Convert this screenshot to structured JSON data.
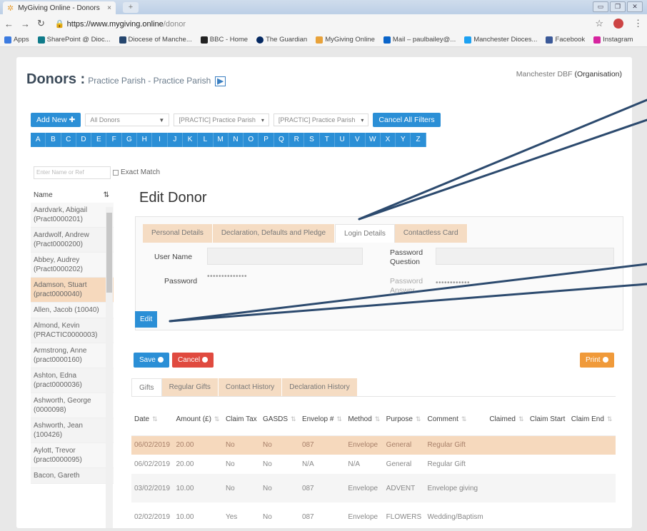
{
  "browser": {
    "tab_title": "MyGiving Online - Donors",
    "url_host": "https://www.mygiving.online",
    "url_path": "/donor",
    "bookmarks": [
      "Apps",
      "SharePoint @ Dioc...",
      "Diocese of Manche...",
      "BBC - Home",
      "The Guardian",
      "MyGiving Online",
      "Mail – paulbailey@...",
      "Manchester Dioces...",
      "Facebook",
      "Instagram"
    ]
  },
  "header": {
    "title": "Donors :",
    "subtitle": "Practice Parish - Practice Parish",
    "organisation_name": "Manchester DBF",
    "organisation_type": "(Organisation)"
  },
  "toolbar": {
    "add_new": "Add New",
    "filter_all": "All Donors",
    "filter_parish1": "[PRACTIC] Practice Parish",
    "filter_parish2": "[PRACTIC] Practice Parish",
    "cancel_filters": "Cancel All Filters"
  },
  "alphabet": [
    "A",
    "B",
    "C",
    "D",
    "E",
    "F",
    "G",
    "H",
    "I",
    "J",
    "K",
    "L",
    "M",
    "N",
    "O",
    "P",
    "Q",
    "R",
    "S",
    "T",
    "U",
    "V",
    "W",
    "X",
    "Y",
    "Z"
  ],
  "search": {
    "placeholder": "Enter Name or Ref",
    "exact_match": "Exact Match"
  },
  "donor_list": {
    "header": "Name",
    "items": [
      "Aardvark, Abigail (Pract0000201)",
      "Aardwolf, Andrew (Pract0000200)",
      "Abbey, Audrey (Pract0000202)",
      "Adamson, Stuart (pract0000040)",
      "Allen, Jacob (10040)",
      "Almond, Kevin (PRACTIC0000003)",
      "Armstrong, Anne (pract0000160)",
      "Ashton, Edna (pract0000036)",
      "Ashworth, George (0000098)",
      "Ashworth, Jean (100426)",
      "Aylott, Trevor (pract0000095)",
      "Bacon, Gareth"
    ]
  },
  "edit_donor": {
    "title": "Edit Donor",
    "tabs": [
      "Personal Details",
      "Declaration, Defaults and Pledge",
      "Login Details",
      "Contactless Card"
    ],
    "user_name_label": "User Name",
    "password_label": "Password",
    "password_value": "••••••••••••••",
    "password_question_label": "Password Question",
    "password_answer_label": "Password Answer",
    "password_answer_value": "••••••••••••",
    "edit_button": "Edit"
  },
  "actions": {
    "save": "Save",
    "cancel": "Cancel",
    "print": "Print"
  },
  "gift_tabs": [
    "Gifts",
    "Regular Gifts",
    "Contact History",
    "Declaration History"
  ],
  "gifts_table": {
    "columns": [
      "Date",
      "Amount (£)",
      "Claim Tax",
      "GASDS",
      "Envelop #",
      "Method",
      "Purpose",
      "Comment",
      "Claimed",
      "Claim Start",
      "Claim End"
    ],
    "rows": [
      [
        "06/02/2019",
        "20.00",
        "No",
        "No",
        "087",
        "Envelope",
        "General",
        "Regular Gift",
        "",
        "",
        ""
      ],
      [
        "06/02/2019",
        "20.00",
        "No",
        "No",
        "N/A",
        "N/A",
        "General",
        "Regular Gift",
        "",
        "",
        ""
      ],
      [
        "03/02/2019",
        "10.00",
        "No",
        "No",
        "087",
        "Envelope",
        "ADVENT",
        "Envelope giving",
        "",
        "",
        ""
      ],
      [
        "02/02/2019",
        "10.00",
        "Yes",
        "No",
        "087",
        "Envelope",
        "FLOWERS",
        "Wedding/Baptism",
        "",
        "",
        ""
      ]
    ]
  },
  "colors": {
    "primary": "#2b8fd6",
    "highlight": "#f6d9bd",
    "danger": "#e04a3f",
    "print": "#f09a3a",
    "arrow": "#2c4a6e"
  }
}
